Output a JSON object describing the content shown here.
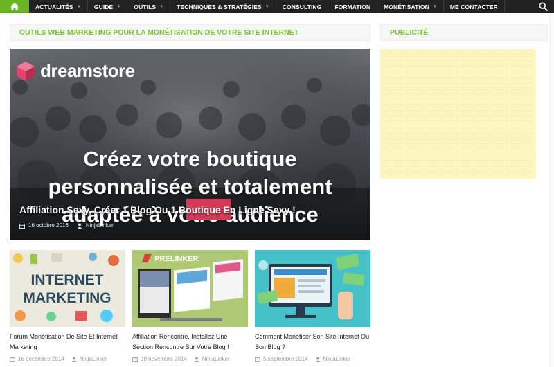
{
  "nav": {
    "items": [
      {
        "label": "ACTUALITÉS",
        "dropdown": true
      },
      {
        "label": "GUIDE",
        "dropdown": true
      },
      {
        "label": "OUTILS",
        "dropdown": true
      },
      {
        "label": "TECHNIQUES & STRATÉGIES",
        "dropdown": true
      },
      {
        "label": "CONSULTING",
        "dropdown": false
      },
      {
        "label": "FORMATION",
        "dropdown": false
      },
      {
        "label": "MONÉTISATION",
        "dropdown": true
      },
      {
        "label": "ME CONTACTER",
        "dropdown": false
      }
    ],
    "home_icon": "home-icon",
    "search_icon": "search-icon"
  },
  "colors": {
    "nav_bg": "#222222",
    "accent_green": "#7cc33a",
    "home_green": "#6bb523",
    "cta_pink": "#d43a58",
    "ad_yellow": "#fdf7c4"
  },
  "main": {
    "section_title": "OUTILS WEB MARKETING POUR LA MONÉTISATION DE VOTRE SITE INTERNET",
    "featured": {
      "brand": "dreamstore",
      "headline": [
        "Créez votre boutique",
        "personnalisée et totalement",
        "adaptée à votre audience"
      ],
      "title": "Affiliation Sexy, Créer 1 Blog Ou 1 Boutique En Ligne Sexy !",
      "date": "16 octobre 2016",
      "author": "NinjaLinker"
    },
    "cards": [
      {
        "image_text": [
          "INTERNET",
          "MARKETING"
        ],
        "title": "Forum Monétisation De Site Et Internet Marketing",
        "date": "16 décembre 2014",
        "author": "NinjaLinker"
      },
      {
        "image_text": [
          "PRELINKER"
        ],
        "title": "Affiliation Rencontre, Installez Une Section Rencontre Sur Votre Blog !",
        "date": "30 novembre 2014",
        "author": "NinjaLinker"
      },
      {
        "image_text": [],
        "title": "Comment Monétiser Son Site Internet Ou Son Blog ?",
        "date": "5 septembre 2014",
        "author": "NinjaLinker"
      }
    ]
  },
  "sidebar": {
    "section_title": "PUBLICITÉ"
  }
}
